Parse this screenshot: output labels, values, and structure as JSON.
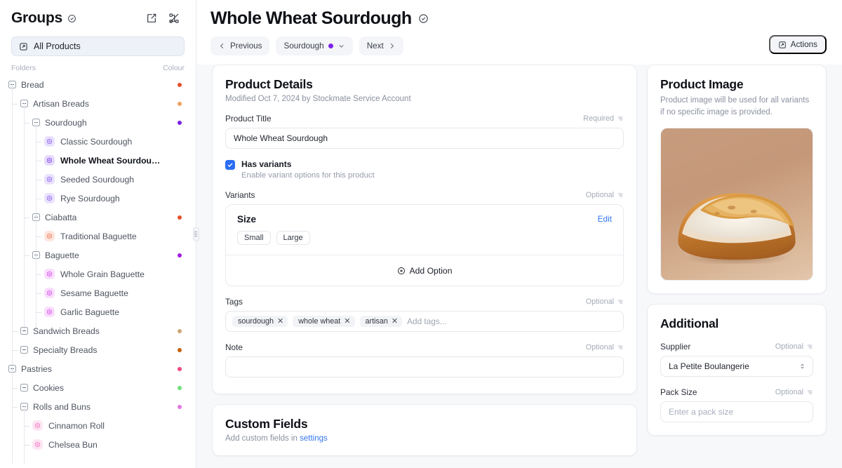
{
  "sidebar": {
    "title": "Groups",
    "title_icon": "check-circle-icon",
    "edit_icon": "edit-square-icon",
    "collapse_all_icon": "collapse-hierarchy-icon",
    "all_products_label": "All Products",
    "col_folders": "Folders",
    "col_colour": "Colour",
    "tree": [
      {
        "label": "Bread",
        "depth": 0,
        "type": "folder",
        "dot": "#e8502a"
      },
      {
        "label": "Artisan Breads",
        "depth": 1,
        "type": "folder",
        "dot": "#eda25f"
      },
      {
        "label": "Sourdough",
        "depth": 2,
        "type": "folder",
        "dot": "#7c22e8"
      },
      {
        "label": "Classic Sourdough",
        "depth": 3,
        "type": "product",
        "accent": "#8b5cf6"
      },
      {
        "label": "Whole Wheat Sourdou…",
        "depth": 3,
        "type": "product",
        "accent": "#7c3aed",
        "selected": true
      },
      {
        "label": "Seeded Sourdough",
        "depth": 3,
        "type": "product",
        "accent": "#8b5cf6"
      },
      {
        "label": "Rye Sourdough",
        "depth": 3,
        "type": "product",
        "accent": "#8b5cf6"
      },
      {
        "label": "Ciabatta",
        "depth": 2,
        "type": "folder",
        "dot": "#e8502a"
      },
      {
        "label": "Traditional Baguette",
        "depth": 3,
        "type": "product",
        "accent": "#f2724f"
      },
      {
        "label": "Baguette",
        "depth": 2,
        "type": "folder",
        "dot": "#a21ce0"
      },
      {
        "label": "Whole Grain Baguette",
        "depth": 3,
        "type": "product",
        "accent": "#d946ef"
      },
      {
        "label": "Sesame Baguette",
        "depth": 3,
        "type": "product",
        "accent": "#d946ef"
      },
      {
        "label": "Garlic Baguette",
        "depth": 3,
        "type": "product",
        "accent": "#d946ef"
      },
      {
        "label": "Sandwich Breads",
        "depth": 1,
        "type": "folder",
        "dot": "#cfa677"
      },
      {
        "label": "Specialty Breads",
        "depth": 1,
        "type": "folder",
        "dot": "#c8620e"
      },
      {
        "label": "Pastries",
        "depth": 0,
        "type": "folder",
        "dot": "#ef4a85"
      },
      {
        "label": "Cookies",
        "depth": 1,
        "type": "folder",
        "dot": "#6ee07c"
      },
      {
        "label": "Rolls and Buns",
        "depth": 1,
        "type": "folder",
        "dot": "#e07ae0"
      },
      {
        "label": "Cinnamon Roll",
        "depth": 2,
        "type": "product",
        "accent": "#f472c0"
      },
      {
        "label": "Chelsea Bun",
        "depth": 2,
        "type": "product",
        "accent": "#f472c0"
      }
    ]
  },
  "header": {
    "page_title": "Whole Wheat Sourdough",
    "title_icon": "check-circle-icon",
    "previous_label": "Previous",
    "group_label": "Sourdough",
    "group_dot_color": "#7c22e8",
    "next_label": "Next",
    "actions_label": "Actions",
    "actions_icon": "external-square-icon"
  },
  "product_details": {
    "heading": "Product Details",
    "modified": "Modified Oct 7, 2024 by Stockmate Service Account",
    "title_field": {
      "label": "Product Title",
      "meta": "Required",
      "value": "Whole Wheat Sourdough"
    },
    "has_variants": {
      "checked": true,
      "label": "Has variants",
      "description": "Enable variant options for this product"
    },
    "variants": {
      "label": "Variants",
      "meta": "Optional",
      "option_name": "Size",
      "edit_label": "Edit",
      "values": [
        "Small",
        "Large"
      ],
      "add_option_label": "Add Option"
    },
    "tags": {
      "label": "Tags",
      "meta": "Optional",
      "items": [
        "sourdough",
        "whole wheat",
        "artisan"
      ],
      "placeholder": "Add tags..."
    },
    "note": {
      "label": "Note",
      "meta": "Optional",
      "value": "",
      "placeholder": ""
    }
  },
  "custom_fields": {
    "heading": "Custom Fields",
    "hint_prefix": "Add custom fields in ",
    "hint_link": "settings"
  },
  "product_image": {
    "heading": "Product Image",
    "description": "Product image will be used for all variants if no specific image is provided.",
    "image_alt": "sourdough-loaf"
  },
  "additional": {
    "heading": "Additional",
    "supplier": {
      "label": "Supplier",
      "meta": "Optional",
      "value": "La Petite Boulangerie"
    },
    "pack_size": {
      "label": "Pack Size",
      "meta": "Optional",
      "value": "",
      "placeholder": "Enter a pack size"
    }
  }
}
